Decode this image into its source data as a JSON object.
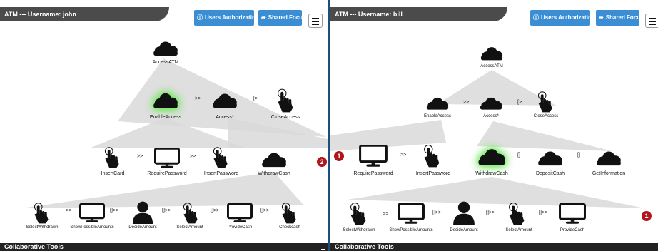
{
  "left": {
    "title": "ATM --- Username: john",
    "auth_button": "Users Authorizations",
    "focus_button": "Shared Focus",
    "badge": "2",
    "labels": {
      "access_atm": "AccessATM",
      "enable_access": "EnableAccess",
      "access_star": "Access*",
      "close_access": "CloseAccess",
      "insert_card": "InsertCard",
      "require_password": "RequirePassword",
      "insert_password": "InsertPassword",
      "withdraw_cash": "WithdrawCash",
      "select_withdrawn": "SelectWithdrawn",
      "show_possible_amounts": "ShowPossibleAmounts",
      "decide_amount": "DecideAmount",
      "select_amount": "SelectAmount",
      "provide_cash": "ProvideCash",
      "checkcash": "Checkcash"
    },
    "ops": {
      "enable_to_access": ">>",
      "access_to_close": "[>",
      "card_to_req": ">>",
      "req_to_ins": ">>",
      "sel_to_show": ">>",
      "show_to_decide": "[]>>",
      "decide_to_select": "[]>>",
      "select_to_provide": "[]>>",
      "provide_to_check": "[]>>"
    },
    "footer": "Collaborative Tools"
  },
  "right": {
    "title": "ATM --- Username: bill",
    "auth_button": "Users Authorizations",
    "focus_button": "Shared Focus",
    "badge_left": "1",
    "badge_right": "1",
    "labels": {
      "access_atm": "AccessATM",
      "enable_access": "EnableAccess",
      "access_star": "Access*",
      "close_access": "CloseAccess",
      "require_password": "RequirePassword",
      "insert_password": "InsertPassword",
      "withdraw_cash": "WithdrawCash",
      "deposit_cash": "DepositCash",
      "get_information": "GetInformation",
      "select_withdrawn": "SelectWithdrawn",
      "show_possible_amounts": "ShowPossibleAmounts",
      "decide_amount": "DecideAmount",
      "select_amount": "SelectAmount",
      "provide_cash": "ProvideCash"
    },
    "ops": {
      "enable_to_access": ">>",
      "access_to_close": "[>",
      "req_to_ins": ">>",
      "withdraw_to_deposit": "[]",
      "deposit_to_info": "[]",
      "sel_to_show": ">>",
      "show_to_decide": "[]>>",
      "decide_to_select": "[]>>",
      "select_to_provide": "[]>>"
    },
    "footer": "Collaborative Tools"
  },
  "icons": {
    "abstract_task": "cloud-icon",
    "interaction_task": "hand-pointer-icon",
    "application_task": "monitor-icon",
    "user_task": "person-icon",
    "auth_button_icon": "info-circle-icon",
    "focus_button_icon": "share-arrow-icon",
    "menu": "hamburger-menu-icon"
  },
  "colors": {
    "button_blue": "#3b8ed4",
    "title_bar": "#4b4b4b",
    "footer": "#222222",
    "badge_red": "#b0171c",
    "highlight_green": "#6fe85a"
  }
}
